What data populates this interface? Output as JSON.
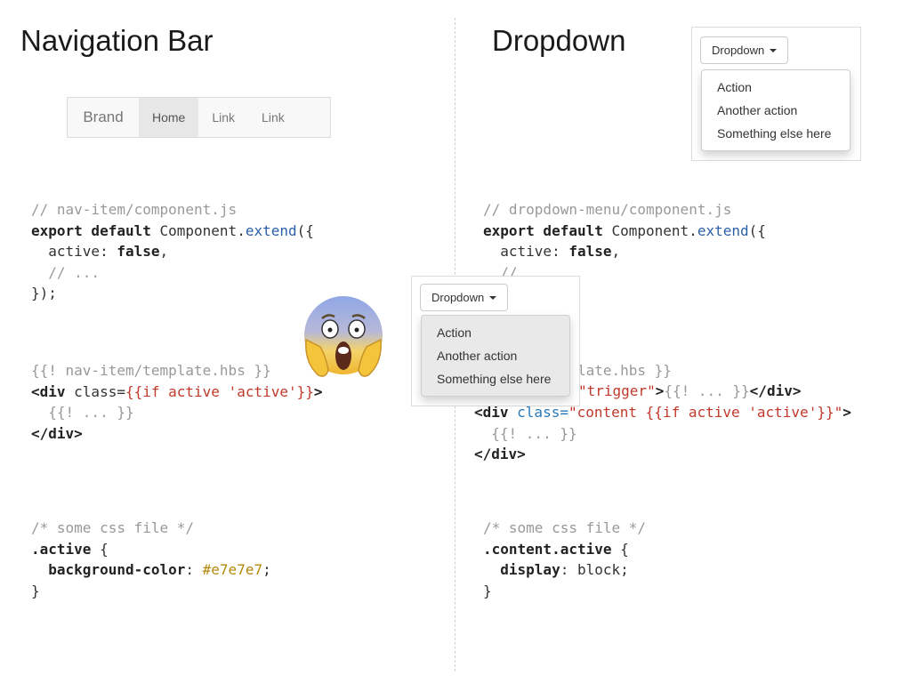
{
  "titles": {
    "left": "Navigation Bar",
    "right": "Dropdown"
  },
  "navbar": {
    "brand": "Brand",
    "items": [
      {
        "label": "Home",
        "active": true
      },
      {
        "label": "Link",
        "active": false
      },
      {
        "label": "Link",
        "active": false
      }
    ],
    "colors": {
      "background": "#f8f8f8",
      "active": "#e7e7e7"
    }
  },
  "dropdown_top": {
    "button_label": "Dropdown",
    "items": [
      "Action",
      "Another action",
      "Something else here"
    ]
  },
  "dropdown_overlay": {
    "button_label": "Dropdown",
    "items": [
      "Action",
      "Another action",
      "Something else here"
    ]
  },
  "emoji": {
    "icon": "face-screaming-in-fear-icon"
  },
  "code": {
    "left_js": {
      "comment": "// nav-item/component.js",
      "kw_export": "export default",
      "component": " Component.",
      "extend": "extend",
      "open": "({",
      "prop": "  active: ",
      "value": "false",
      "comma": ",",
      "ellipsis_comment": "  // ...",
      "close": "});"
    },
    "left_hbs": {
      "comment": "{{! nav-item/template.hbs }}",
      "tag_open": "<div",
      "attr": " class=",
      "attr_value": "{{if active 'active'}}",
      "tag_end": ">",
      "body": "  {{! ... }}",
      "tag_close": "</div>"
    },
    "left_css": {
      "comment": "/* some css file */",
      "selector": ".active",
      "open": " {",
      "prop": "  background-color",
      "colon": ": ",
      "value": "#e7e7e7",
      "semi": ";",
      "close": "}"
    },
    "right_js": {
      "comment": "// dropdown-menu/component.js",
      "kw_export": "export default",
      "component": " Component.",
      "extend": "extend",
      "open": "({",
      "prop": "  active: ",
      "value": "false",
      "comma": ",",
      "partial": "  //"
    },
    "right_hbs": {
      "line1_tail": "n-menu/template.hbs }}",
      "line2_tail_value": "\"trigger\"",
      "line2_tail_rest": ">{{! ... }}",
      "line2_tail_close": "</div>",
      "line3_tag": "<div",
      "line3_attr": " class=",
      "line3_value": "\"content {{if active 'active'}}\"",
      "line3_end": ">",
      "body": "  {{! ... }}",
      "tag_close": "</div>"
    },
    "right_css": {
      "comment": "/* some css file */",
      "selector": ".content.active",
      "open": " {",
      "prop": "  display",
      "colon": ": ",
      "value": "block",
      "semi": ";",
      "close": "}"
    }
  }
}
